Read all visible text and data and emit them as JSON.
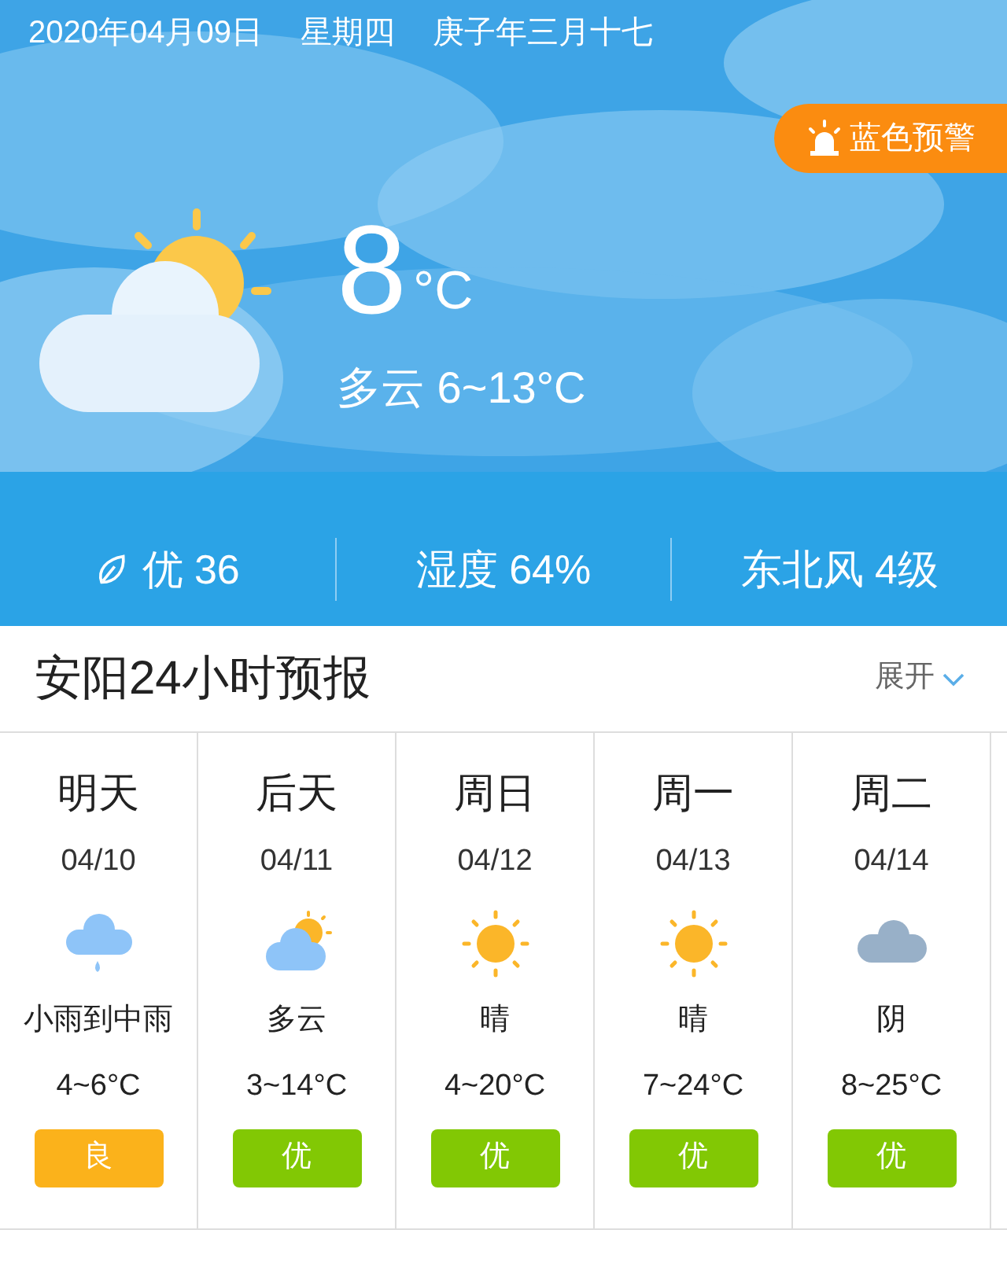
{
  "header": {
    "date": "2020年04月09日",
    "weekday": "星期四",
    "lunar": "庚子年三月十七",
    "alert": "蓝色预警",
    "current": {
      "kind": "partly_cloudy",
      "temp": "8",
      "unit": "°C",
      "summary": "多云 6~13°C"
    },
    "stats": [
      {
        "kind": "aqi",
        "text": "优 36"
      },
      {
        "kind": "plain",
        "text": "湿度 64%"
      },
      {
        "kind": "plain",
        "text": "东北风 4级"
      }
    ]
  },
  "forecast_section": {
    "title": "安阳24小时预报",
    "expand": "展开"
  },
  "days": [
    {
      "day": "明天",
      "date": "04/10",
      "kind": "rain",
      "weather": "小雨到中雨",
      "temp": "4~6°C",
      "aqi": "良",
      "color": "#fbb21b"
    },
    {
      "day": "后天",
      "date": "04/11",
      "kind": "partly_cloudy",
      "weather": "多云",
      "temp": "3~14°C",
      "aqi": "优",
      "color": "#82c804"
    },
    {
      "day": "周日",
      "date": "04/12",
      "kind": "sunny",
      "weather": "晴",
      "temp": "4~20°C",
      "aqi": "优",
      "color": "#82c804"
    },
    {
      "day": "周一",
      "date": "04/13",
      "kind": "sunny",
      "weather": "晴",
      "temp": "7~24°C",
      "aqi": "优",
      "color": "#82c804"
    },
    {
      "day": "周二",
      "date": "04/14",
      "kind": "overcast",
      "weather": "阴",
      "temp": "8~25°C",
      "aqi": "优",
      "color": "#82c804"
    }
  ]
}
